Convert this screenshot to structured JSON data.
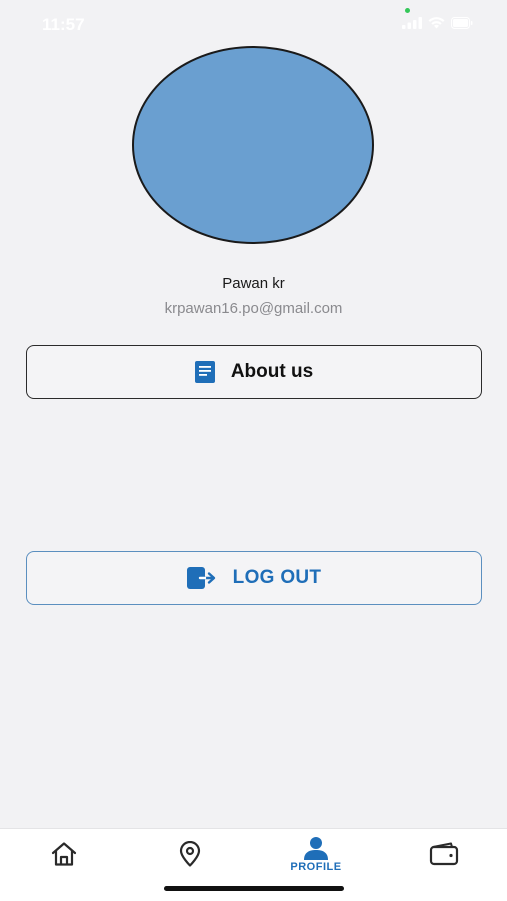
{
  "status_bar": {
    "time": "11:57"
  },
  "profile": {
    "name": "Pawan kr",
    "email": "krpawan16.po@gmail.com",
    "avatar_color": "#6a9fd0"
  },
  "buttons": {
    "about_label": "About us",
    "about_icon": "document-icon",
    "logout_label": "LOG OUT",
    "logout_icon": "logout-icon"
  },
  "tab_bar": {
    "active_tab": "profile",
    "accent_color": "#1f6eb8",
    "tabs": [
      {
        "id": "home",
        "icon": "home-icon",
        "label": ""
      },
      {
        "id": "location",
        "icon": "location-pin-icon",
        "label": ""
      },
      {
        "id": "profile",
        "icon": "person-icon",
        "label": "PROFILE"
      },
      {
        "id": "wallet",
        "icon": "wallet-icon",
        "label": ""
      }
    ]
  }
}
